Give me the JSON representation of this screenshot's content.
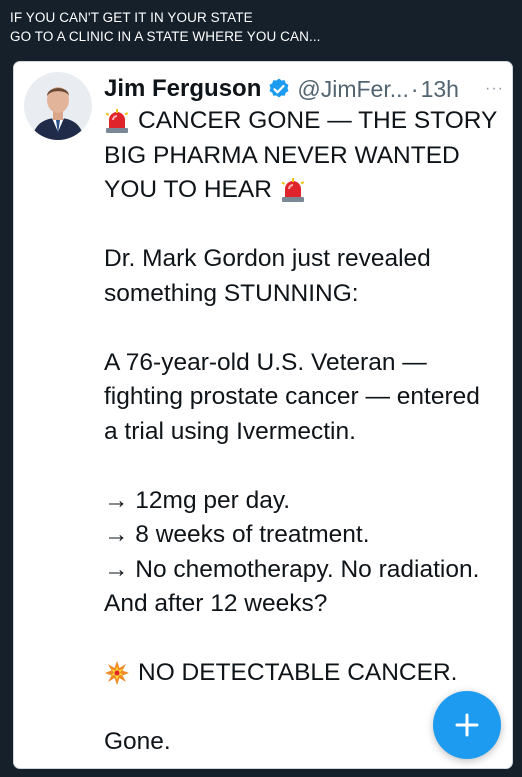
{
  "caption": {
    "line1": "IF YOU CAN'T GET IT IN YOUR STATE",
    "line2": "GO TO A CLINIC IN A STATE WHERE YOU CAN..."
  },
  "tweet": {
    "author_name": "Jim Ferguson",
    "handle": "@JimFer...",
    "separator": "·",
    "time": "13h",
    "more_label": "···",
    "lines": {
      "l1": "CANCER GONE — THE STORY",
      "l2": "BIG PHARMA NEVER WANTED",
      "l3": "YOU TO HEAR",
      "l4": "Dr. Mark Gordon just revealed",
      "l5": "something STUNNING:",
      "l6": "A 76-year-old U.S. Veteran —",
      "l7": "fighting prostate cancer — entered",
      "l8": "a trial using Ivermectin.",
      "l9": "→ 12mg per day.",
      "l10": "→ 8 weeks of treatment.",
      "l11": "→ No chemotherapy. No radiation.",
      "l12": "And after 12 weeks?",
      "l13": "NO DETECTABLE CANCER.",
      "l14": "Gone."
    },
    "icons": {
      "siren": "police-car-light-emoji",
      "collision": "collision-emoji",
      "verified": "verified-badge-icon"
    }
  },
  "fab": {
    "icon": "plus-icon",
    "color": "#1d9bf0"
  }
}
